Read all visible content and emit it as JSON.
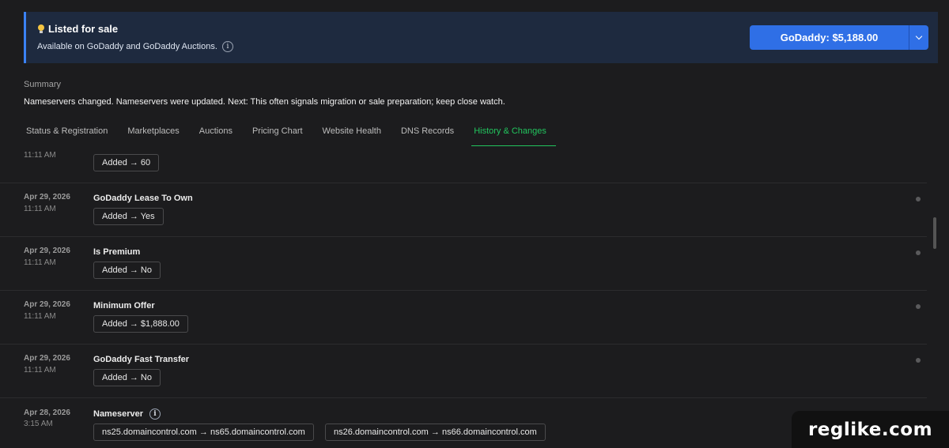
{
  "banner": {
    "title": "Listed for sale",
    "subtitle": "Available on GoDaddy and GoDaddy Auctions.",
    "accent_color": "#3b82f6",
    "buy_button_label": "GoDaddy: $5,188.00",
    "button_color": "#2f6fe6"
  },
  "summary": {
    "label": "Summary",
    "text": "Nameservers changed. Nameservers were updated. Next: This often signals migration or sale preparation; keep close watch."
  },
  "tabs": [
    {
      "label": "Status & Registration"
    },
    {
      "label": "Marketplaces"
    },
    {
      "label": "Auctions"
    },
    {
      "label": "Pricing Chart"
    },
    {
      "label": "Website Health"
    },
    {
      "label": "DNS Records"
    },
    {
      "label": "History & Changes",
      "active": true
    }
  ],
  "active_tab_color": "#22c55e",
  "history": [
    {
      "date": "",
      "time": "11:11 AM",
      "field": "",
      "changes": [
        "Added → 60"
      ]
    },
    {
      "date": "Apr 29, 2026",
      "time": "11:11 AM",
      "field": "GoDaddy Lease To Own",
      "changes": [
        "Added → Yes"
      ]
    },
    {
      "date": "Apr 29, 2026",
      "time": "11:11 AM",
      "field": "Is Premium",
      "changes": [
        "Added → No"
      ]
    },
    {
      "date": "Apr 29, 2026",
      "time": "11:11 AM",
      "field": "Minimum Offer",
      "changes": [
        "Added → $1,888.00"
      ]
    },
    {
      "date": "Apr 29, 2026",
      "time": "11:11 AM",
      "field": "GoDaddy Fast Transfer",
      "changes": [
        "Added → No"
      ]
    },
    {
      "date": "Apr 28, 2026",
      "time": "3:15 AM",
      "field": "Nameserver",
      "changes": [
        "ns25.domaincontrol.com → ns65.domaincontrol.com",
        "ns26.domaincontrol.com → ns66.domaincontrol.com"
      ]
    }
  ],
  "watermark": "reglike.com"
}
